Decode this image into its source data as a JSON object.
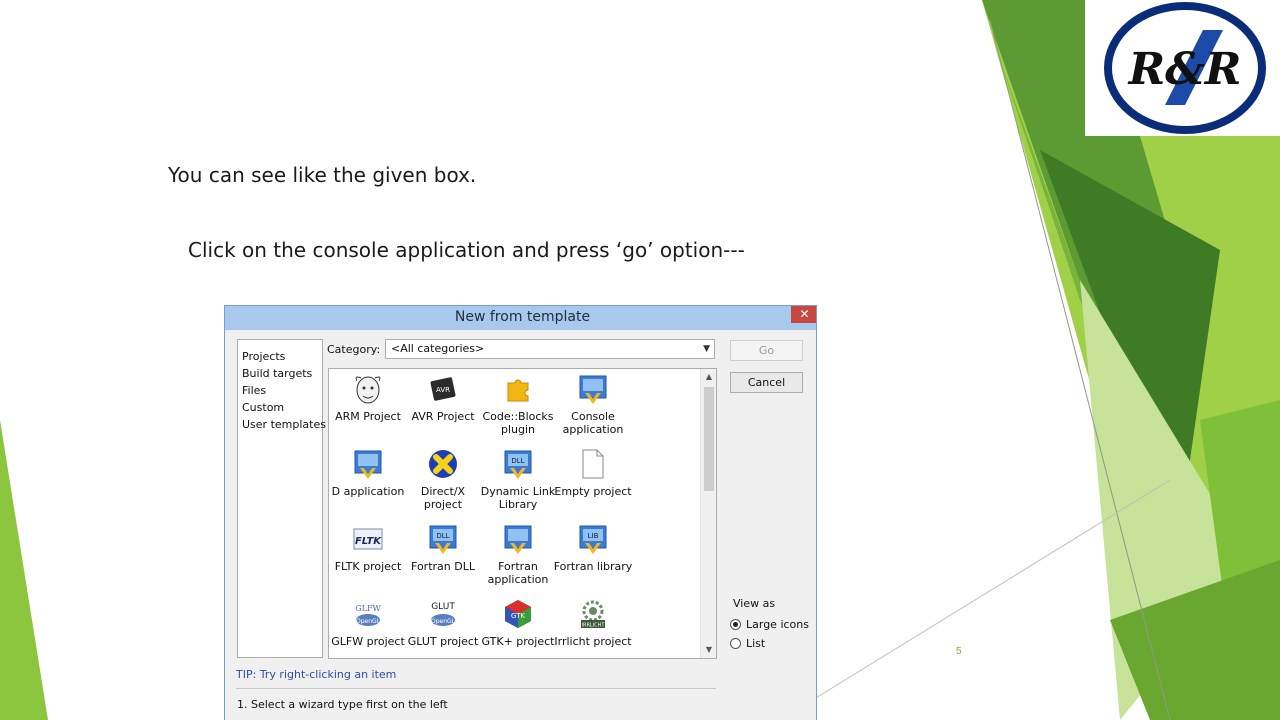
{
  "slide": {
    "line1": "You can see like the given box.",
    "line2": "Click on the console application and press ‘go’ option---",
    "number": "5",
    "logo_text": "R&R"
  },
  "colors": {
    "accent_green": "#8cc63f",
    "dark_green": "#4f8a2a",
    "logo_blue": "#0a2d7a",
    "titlebar": "#a9c8ee"
  },
  "dialog": {
    "title": "New from template",
    "close_icon": "close-icon",
    "categories": [
      "Projects",
      "Build targets",
      "Files",
      "Custom",
      "User templates"
    ],
    "category_label": "Category:",
    "category_value": "<All categories>",
    "go_label": "Go",
    "cancel_label": "Cancel",
    "view_as_label": "View as",
    "view_options": [
      "Large icons",
      "List"
    ],
    "selected_view": "Large icons",
    "tip": "TIP: Try right-clicking an item",
    "step": "1. Select a wizard type first on the left",
    "templates": [
      {
        "label": "ARM Project",
        "icon": "gnu-icon"
      },
      {
        "label": "AVR Project",
        "icon": "avr-chip-icon"
      },
      {
        "label": "Code::Blocks\nplugin",
        "icon": "puzzle-icon"
      },
      {
        "label": "Console\napplication",
        "icon": "console-app-icon"
      },
      {
        "label": "D application",
        "icon": "d-app-icon"
      },
      {
        "label": "Direct/X\nproject",
        "icon": "directx-icon"
      },
      {
        "label": "Dynamic Link\nLibrary",
        "icon": "dll-icon"
      },
      {
        "label": "Empty project",
        "icon": "blank-file-icon"
      },
      {
        "label": "FLTK project",
        "icon": "fltk-icon"
      },
      {
        "label": "Fortran DLL",
        "icon": "fortran-dll-icon"
      },
      {
        "label": "Fortran\napplication",
        "icon": "fortran-app-icon"
      },
      {
        "label": "Fortran library",
        "icon": "fortran-lib-icon"
      },
      {
        "label": "GLFW project",
        "icon": "glfw-icon"
      },
      {
        "label": "GLUT project",
        "icon": "glut-icon"
      },
      {
        "label": "GTK+ project",
        "icon": "gtk-icon"
      },
      {
        "label": "Irrlicht project",
        "icon": "irrlicht-icon"
      }
    ]
  }
}
